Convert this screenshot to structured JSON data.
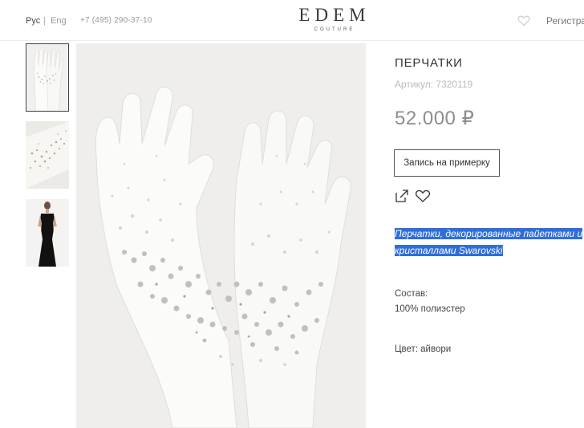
{
  "header": {
    "lang_ru": "Рус",
    "lang_sep": "|",
    "lang_en": "Eng",
    "phone": "+7 (495) 290-37-10",
    "logo_main": "EDEM",
    "logo_sub": "COUTURE",
    "favorites_icon": "heart-icon",
    "register_label": "Регистра"
  },
  "gallery": {
    "thumbnails": [
      "gloves-front",
      "glove-detail",
      "model-in-black-dress"
    ],
    "selected_index": 0
  },
  "product": {
    "title": "ПЕРЧАТКИ",
    "article": "Артикул: 7320119",
    "price": "52.000 ₽",
    "fitting_button": "Запись на примерку",
    "share_icon": "share-icon",
    "wishlist_icon": "heart-icon",
    "description": "Перчатки, декорированные пайетками и кристаллами Swarovski",
    "composition_label": "Состав:",
    "composition_value": "100% полиэстер",
    "color": "Цвет: айвори"
  },
  "colors": {
    "selection": "#2f6ed8",
    "price": "#8d8d8d",
    "article": "#bbbbbb"
  }
}
